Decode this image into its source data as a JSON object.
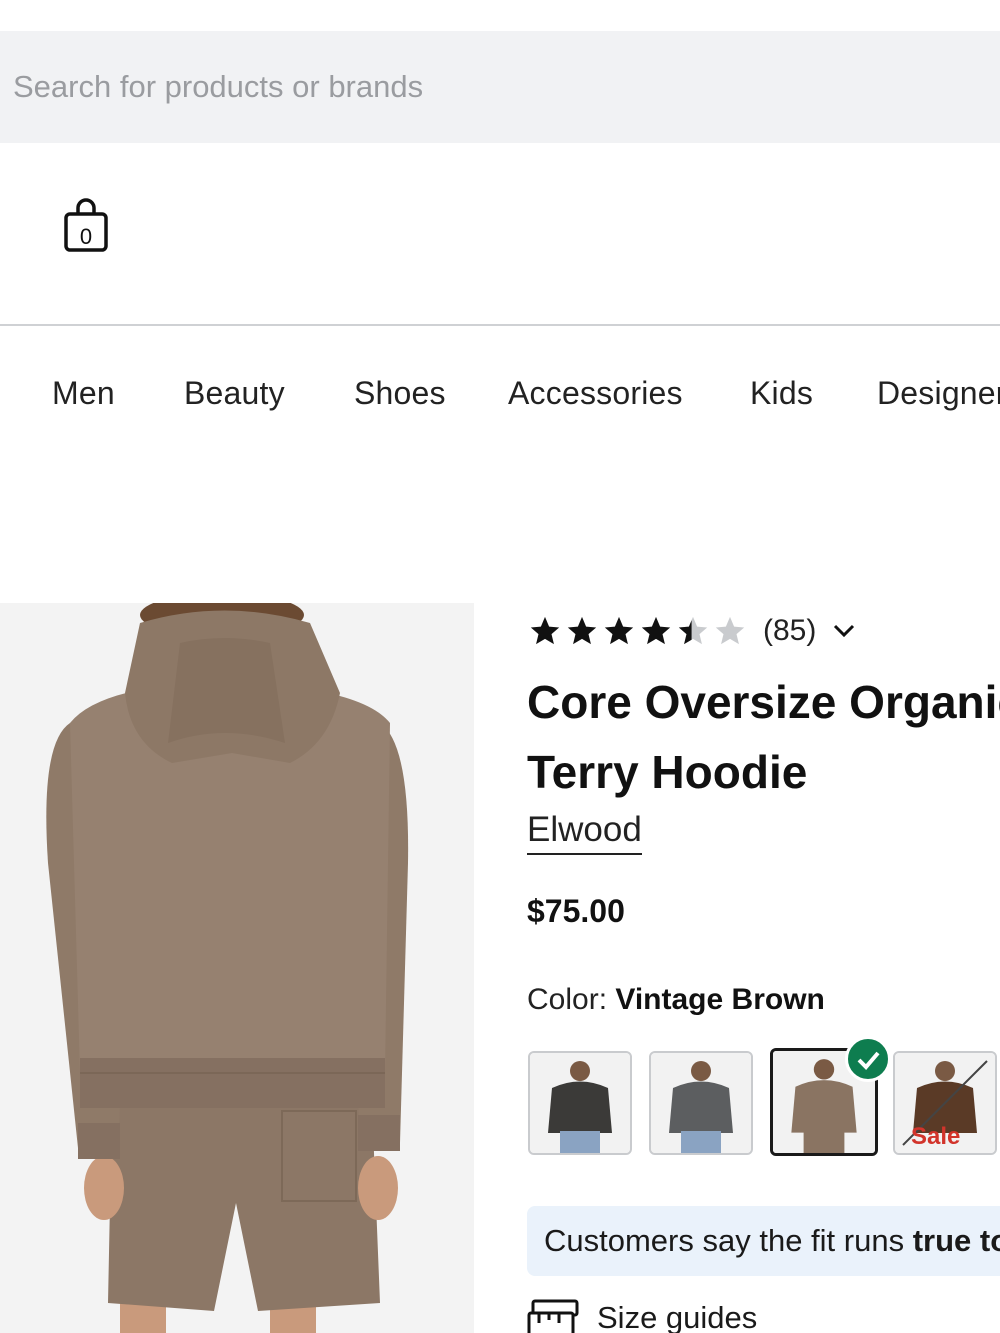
{
  "search": {
    "placeholder": "Search for products or brands"
  },
  "header": {
    "bag_count": "0"
  },
  "nav": {
    "items": [
      "Men",
      "Beauty",
      "Shoes",
      "Accessories",
      "Kids",
      "Designer"
    ]
  },
  "product": {
    "rating": 4.5,
    "rating_max": 5,
    "review_count": "(85)",
    "title_line1": "Core Oversize Organic",
    "title_line2": "Terry Hoodie",
    "brand": "Elwood",
    "price": "$75.00",
    "color_label": "Color:",
    "color_value": "Vintage Brown",
    "swatches": [
      {
        "color": "#3b3a38",
        "selected": false
      },
      {
        "color": "#5c5e60",
        "selected": false
      },
      {
        "color": "#8a7462",
        "selected": true
      },
      {
        "color": "#5a3a26",
        "selected": false,
        "badge": "Sale"
      }
    ],
    "fit_text": "Customers say the fit runs",
    "fit_value": "true to size",
    "size_guides": "Size guides"
  },
  "colors": {
    "search_bg": "#f1f2f4",
    "fit_bg": "#eaf2fb",
    "check": "#0e7d4f",
    "sale": "#d2342b"
  }
}
